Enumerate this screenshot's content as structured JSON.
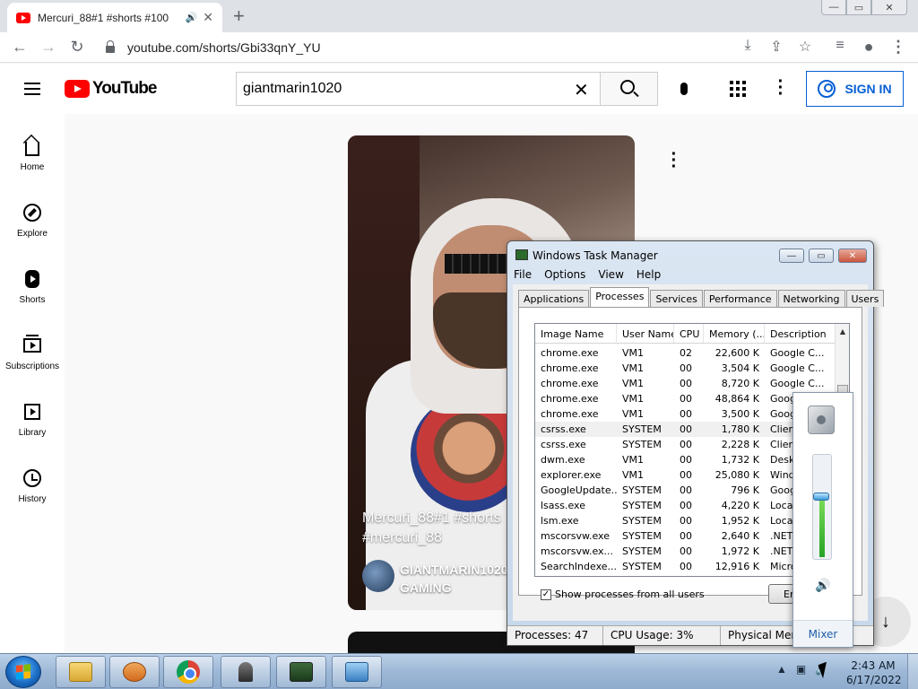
{
  "browser": {
    "tab_title": "Mercuri_88#1 #shorts #100",
    "url": "youtube.com/shorts/Gbi33qnY_YU",
    "new_tab_symbol": "+",
    "window_buttons": [
      "—",
      "▭",
      "✕"
    ]
  },
  "youtube": {
    "logo_text": "YouTube",
    "search_value": "giantmarin1020",
    "sign_in_label": "SIGN IN",
    "sidebar": [
      {
        "label": "Home",
        "icon": "home-icon"
      },
      {
        "label": "Explore",
        "icon": "explore-icon"
      },
      {
        "label": "Shorts",
        "icon": "shorts-icon"
      },
      {
        "label": "Subscriptions",
        "icon": "subscriptions-icon"
      },
      {
        "label": "Library",
        "icon": "library-icon"
      },
      {
        "label": "History",
        "icon": "history-icon"
      }
    ],
    "short": {
      "title": "Mercuri_88#1 #shorts #mercuri_88",
      "channel_line1": "GIANTMARIN1020",
      "channel_line2": "GAMING"
    }
  },
  "task_manager": {
    "title": "Windows Task Manager",
    "menu": [
      "File",
      "Options",
      "View",
      "Help"
    ],
    "tabs": [
      "Applications",
      "Processes",
      "Services",
      "Performance",
      "Networking",
      "Users"
    ],
    "active_tab": "Processes",
    "columns": [
      "Image Name",
      "User Name",
      "CPU",
      "Memory (...",
      "Description"
    ],
    "rows": [
      [
        "chrome.exe",
        "VM1",
        "02",
        "22,600 K",
        "Google C..."
      ],
      [
        "chrome.exe",
        "VM1",
        "00",
        "3,504 K",
        "Google C..."
      ],
      [
        "chrome.exe",
        "VM1",
        "00",
        "8,720 K",
        "Google C..."
      ],
      [
        "chrome.exe",
        "VM1",
        "00",
        "48,864 K",
        "Goog"
      ],
      [
        "chrome.exe",
        "VM1",
        "00",
        "3,500 K",
        "Goog"
      ],
      [
        "csrss.exe",
        "SYSTEM",
        "00",
        "1,780 K",
        "Clien"
      ],
      [
        "csrss.exe",
        "SYSTEM",
        "00",
        "2,228 K",
        "Clien"
      ],
      [
        "dwm.exe",
        "VM1",
        "00",
        "1,732 K",
        "Desk"
      ],
      [
        "explorer.exe",
        "VM1",
        "00",
        "25,080 K",
        "Wind"
      ],
      [
        "GoogleUpdate...",
        "SYSTEM",
        "00",
        "796 K",
        "Goog"
      ],
      [
        "lsass.exe",
        "SYSTEM",
        "00",
        "4,220 K",
        "Local"
      ],
      [
        "lsm.exe",
        "SYSTEM",
        "00",
        "1,952 K",
        "Local"
      ],
      [
        "mscorsvw.exe",
        "SYSTEM",
        "00",
        "2,640 K",
        ".NET"
      ],
      [
        "mscorsvw.ex...",
        "SYSTEM",
        "00",
        "1,972 K",
        ".NET"
      ],
      [
        "SearchIndexe...",
        "SYSTEM",
        "00",
        "12,916 K",
        "Micro"
      ]
    ],
    "show_all_label": "Show processes from all users",
    "show_all_checked": true,
    "end_process_label": "End Process",
    "status": {
      "processes": "Processes: 47",
      "cpu": "CPU Usage: 3%",
      "memory": "Physical Mem"
    }
  },
  "volume": {
    "level": 0.6,
    "mixer_label": "Mixer"
  },
  "taskbar": {
    "apps": [
      "folder-icon",
      "media-player-icon",
      "chrome-icon",
      "chess-icon",
      "task-manager-icon",
      "control-panel-icon"
    ],
    "time": "2:43 AM",
    "date": "6/17/2022"
  }
}
